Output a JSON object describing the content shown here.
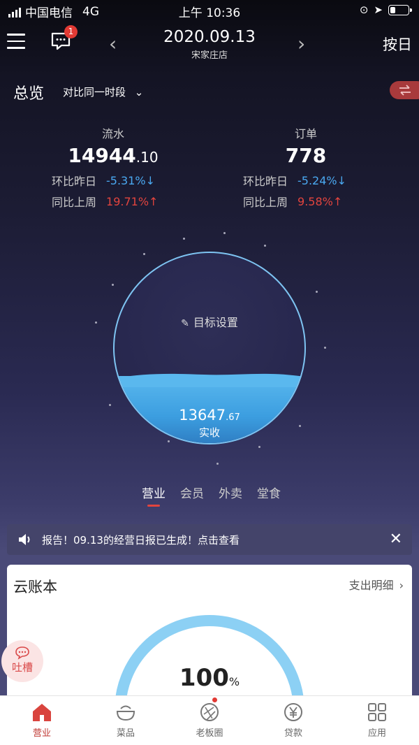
{
  "status_bar": {
    "carrier": "中国电信",
    "network": "4G",
    "time": "上午 10:36",
    "battery_level": 0.3
  },
  "nav": {
    "date": "2020.09.13",
    "store": "宋家庄店",
    "mode": "按日",
    "message_badge": "1",
    "prev_icon": "chevron-left-icon",
    "next_icon": "chevron-right-icon"
  },
  "overview": {
    "title": "总览",
    "compare_label": "对比同一时段"
  },
  "stats": {
    "revenue": {
      "label": "流水",
      "value_int": "14944",
      "value_dec": ".10",
      "dod_label": "环比昨日",
      "dod_value": "-5.31%",
      "wow_label": "同比上周",
      "wow_value": "19.71%"
    },
    "orders": {
      "label": "订单",
      "value": "778",
      "dod_label": "环比昨日",
      "dod_value": "-5.24%",
      "wow_label": "同比上周",
      "wow_value": "9.58%"
    }
  },
  "globe": {
    "target_label": "目标设置",
    "actual_int": "13647",
    "actual_dec": ".67",
    "actual_label": "实收"
  },
  "biz_tabs": [
    {
      "label": "营业",
      "active": true
    },
    {
      "label": "会员",
      "active": false
    },
    {
      "label": "外卖",
      "active": false
    },
    {
      "label": "堂食",
      "active": false
    }
  ],
  "notice": {
    "text": "报告！09.13的经营日报已生成！点击查看"
  },
  "cloud_ledger": {
    "title": "云账本",
    "detail_label": "支出明细",
    "percent": "100",
    "percent_unit": "%"
  },
  "feedback": {
    "label": "吐槽"
  },
  "tabbar": [
    {
      "label": "营业",
      "icon": "home-icon",
      "active": true
    },
    {
      "label": "菜品",
      "icon": "dish-icon",
      "active": false
    },
    {
      "label": "老板圈",
      "icon": "aperture-icon",
      "active": false
    },
    {
      "label": "贷款",
      "icon": "yen-icon",
      "active": false
    },
    {
      "label": "应用",
      "icon": "apps-grid-icon",
      "active": false
    }
  ],
  "colors": {
    "accent_red": "#e2443e",
    "accent_blue": "#4aa8f0",
    "water": "#4aaee8"
  }
}
